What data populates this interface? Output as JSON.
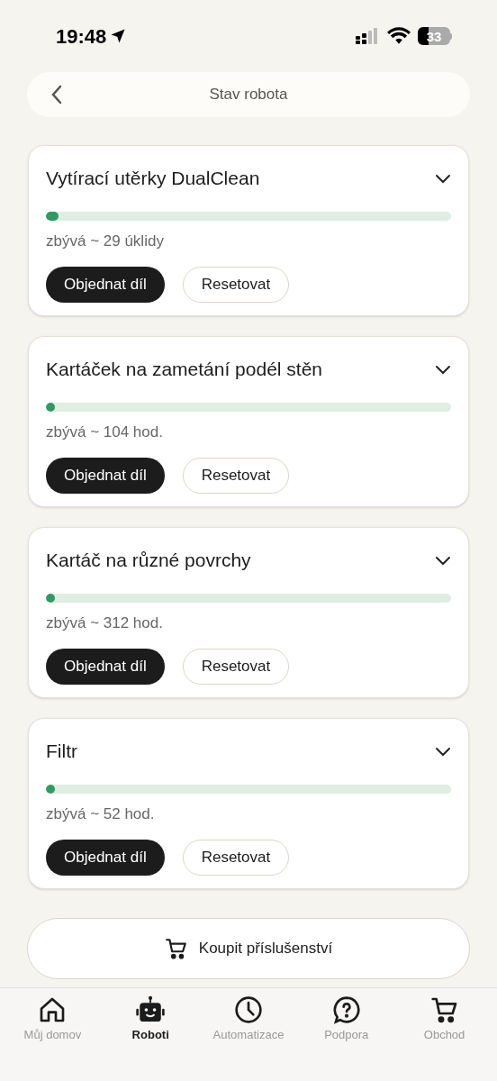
{
  "status_bar": {
    "time": "19:48",
    "battery": "33"
  },
  "header": {
    "title": "Stav robota"
  },
  "parts": [
    {
      "name": "Vytírací utěrky DualClean",
      "level": 0.03,
      "remaining": "zbývá ~ 29 úklidy",
      "order_button": "Objednat díl",
      "reset_button": "Resetovat"
    },
    {
      "name": "Kartáček na zametání podél stěn",
      "level": 0.01,
      "remaining": "zbývá ~ 104 hod.",
      "order_button": "Objednat díl",
      "reset_button": "Resetovat"
    },
    {
      "name": "Kartáč na různé povrchy",
      "level": 0.01,
      "remaining": "zbývá ~ 312 hod.",
      "order_button": "Objednat díl",
      "reset_button": "Resetovat"
    },
    {
      "name": "Filtr",
      "level": 0.01,
      "remaining": "zbývá ~ 52 hod.",
      "order_button": "Objednat díl",
      "reset_button": "Resetovat"
    }
  ],
  "buy_button": "Koupit příslušenství",
  "tab_bar": [
    {
      "kind": "home",
      "label": "Můj domov",
      "selected": false
    },
    {
      "kind": "robot",
      "label": "Roboti",
      "selected": true
    },
    {
      "kind": "clock",
      "label": "Automatizace",
      "selected": false
    },
    {
      "kind": "help",
      "label": "Podpora",
      "selected": false
    },
    {
      "kind": "cart",
      "label": "Obchod",
      "selected": false
    }
  ]
}
